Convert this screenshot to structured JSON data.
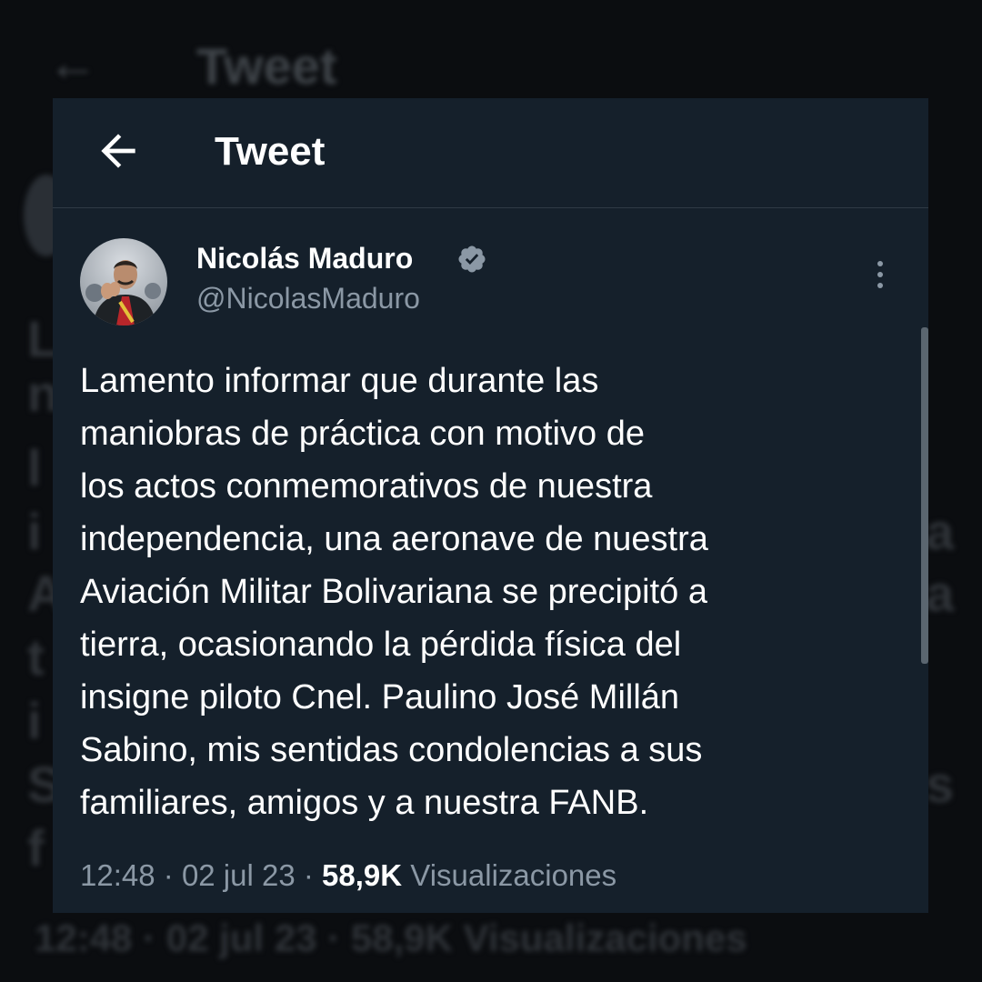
{
  "header": {
    "title": "Tweet"
  },
  "tweet": {
    "author_name": "Nicolás Maduro",
    "author_handle": "@NicolasMaduro",
    "text_lines": [
      "Lamento informar que durante las",
      "maniobras de práctica con motivo de",
      "los actos conmemorativos de nuestra",
      "independencia, una aeronave de nuestra",
      "Aviación Militar Bolivariana se precipitó a",
      "tierra, ocasionando la pérdida física del",
      "insigne piloto Cnel. Paulino José Millán",
      "Sabino, mis sentidas condolencias a sus",
      "familiares, amigos y a nuestra FANB."
    ],
    "time": "12:48",
    "date": "02 jul 23",
    "separator": "·",
    "views_count": "58,9K",
    "views_label": "Visualizaciones"
  },
  "icons": {
    "back": "back-arrow-icon",
    "verified": "verified-badge-icon",
    "more": "more-options-icon"
  },
  "colors": {
    "card_background": "#15202b",
    "verified_badge": "#8b98a5",
    "secondary_text": "#8b98a5"
  }
}
